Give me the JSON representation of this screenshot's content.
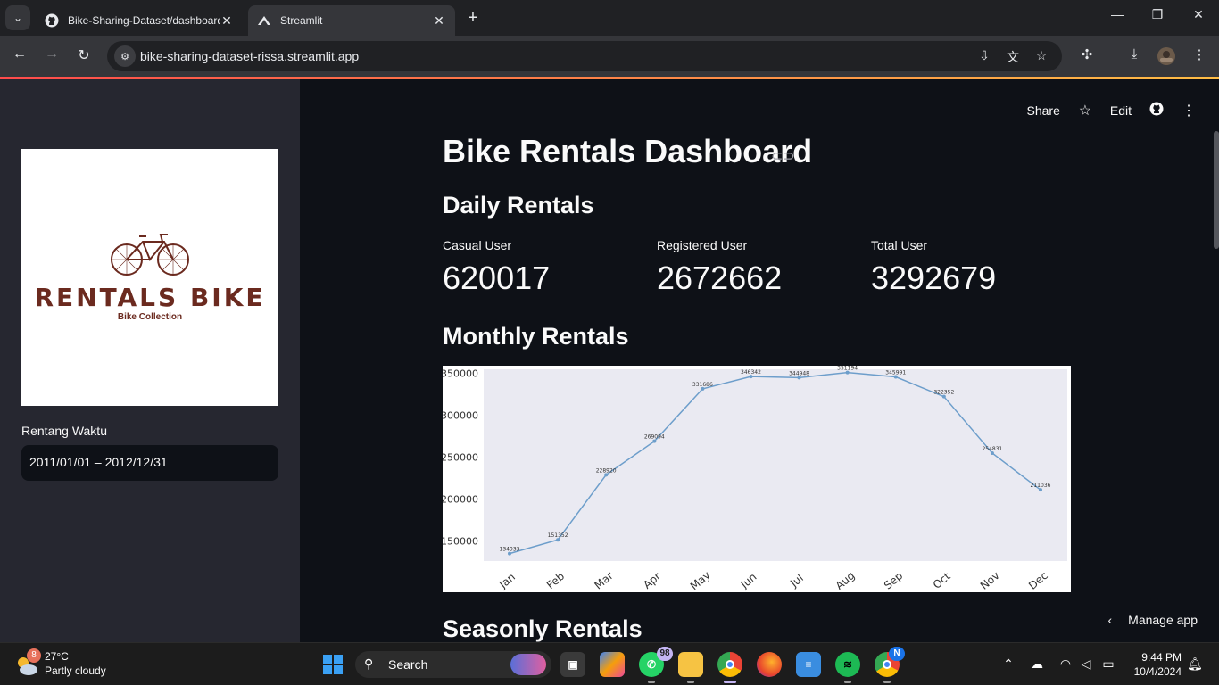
{
  "browser": {
    "tabs": [
      {
        "title": "Bike-Sharing-Dataset/dashboard",
        "favicon": "github-icon",
        "active": false
      },
      {
        "title": "Streamlit",
        "favicon": "streamlit-icon",
        "active": true
      }
    ],
    "url": "bike-sharing-dataset-rissa.streamlit.app",
    "new_tab_symbol": "+",
    "tab_close_symbol": "✕"
  },
  "header": {
    "share_label": "Share",
    "edit_label": "Edit"
  },
  "sidebar": {
    "logo": {
      "title": "RENTALS BIKE",
      "subtitle": "Bike Collection"
    },
    "date_range_label": "Rentang Waktu",
    "date_range_value": "2011/01/01 – 2012/12/31"
  },
  "main": {
    "title": "Bike Rentals Dashboard",
    "daily_heading": "Daily Rentals",
    "metrics": [
      {
        "label": "Casual User",
        "value": "620017"
      },
      {
        "label": "Registered User",
        "value": "2672662"
      },
      {
        "label": "Total User",
        "value": "3292679"
      }
    ],
    "monthly_heading": "Monthly Rentals",
    "seasonly_heading": "Seasonly Rentals",
    "manage_app_label": "Manage app"
  },
  "chart_data": {
    "type": "line",
    "categories": [
      "Jan",
      "Feb",
      "Mar",
      "Apr",
      "May",
      "Jun",
      "Jul",
      "Aug",
      "Sep",
      "Oct",
      "Nov",
      "Dec"
    ],
    "values": [
      134933,
      151352,
      228920,
      269094,
      331686,
      346342,
      344948,
      351194,
      345991,
      322352,
      254831,
      211036
    ],
    "value_labels": [
      "134933",
      "151352",
      "228920",
      "269094",
      "331686",
      "346342",
      "344948",
      "351194",
      "345991",
      "322352",
      "254831",
      "211036"
    ],
    "yticks": [
      "150000",
      "200000",
      "250000",
      "300000",
      "350000"
    ],
    "ylim": [
      126000,
      355000
    ],
    "line_color": "#6d9ecb",
    "plot_bg": "#eaeaf2",
    "grid": false,
    "title": "",
    "xlabel": "",
    "ylabel": ""
  },
  "taskbar": {
    "weather_temp": "27°C",
    "weather_condition": "Partly cloudy",
    "weather_badge": "8",
    "search_label": "Search",
    "whatsapp_badge": "98",
    "chrome_profile_badge": "N",
    "time": "9:44 PM",
    "date": "10/4/2024"
  }
}
